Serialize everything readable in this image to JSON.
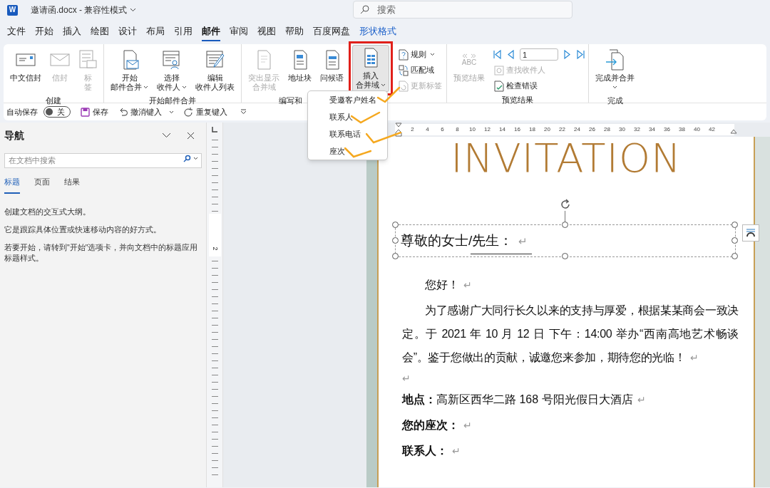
{
  "title_bar": {
    "app_letter": "W",
    "title": "邀请函.docx - 兼容性模式",
    "search_placeholder": "搜索"
  },
  "tabs": [
    {
      "label": "文件",
      "kind": "normal",
      "selected": false
    },
    {
      "label": "开始",
      "kind": "normal",
      "selected": false
    },
    {
      "label": "插入",
      "kind": "normal",
      "selected": false
    },
    {
      "label": "绘图",
      "kind": "normal",
      "selected": false
    },
    {
      "label": "设计",
      "kind": "normal",
      "selected": false
    },
    {
      "label": "布局",
      "kind": "normal",
      "selected": false
    },
    {
      "label": "引用",
      "kind": "normal",
      "selected": false
    },
    {
      "label": "邮件",
      "kind": "normal",
      "selected": true
    },
    {
      "label": "审阅",
      "kind": "normal",
      "selected": false
    },
    {
      "label": "视图",
      "kind": "normal",
      "selected": false
    },
    {
      "label": "帮助",
      "kind": "normal",
      "selected": false
    },
    {
      "label": "百度网盘",
      "kind": "normal",
      "selected": false
    },
    {
      "label": "形状格式",
      "kind": "contextual",
      "selected": false
    }
  ],
  "ribbon": {
    "groups": [
      {
        "label": "创建",
        "items": [
          {
            "kind": "large",
            "lines": [
              "中文信封"
            ],
            "dropdown": false,
            "disabled": false,
            "pressed": false,
            "highlighted": false
          },
          {
            "kind": "large",
            "lines": [
              "信封"
            ],
            "dropdown": false,
            "disabled": true,
            "pressed": false,
            "highlighted": false
          },
          {
            "kind": "large",
            "lines": [
              "标",
              "签"
            ],
            "dropdown": false,
            "disabled": true,
            "pressed": false,
            "highlighted": false
          }
        ]
      },
      {
        "label": "开始邮件合并",
        "items": [
          {
            "kind": "large",
            "lines": [
              "开始",
              "邮件合并"
            ],
            "dropdown": true,
            "disabled": false,
            "pressed": false,
            "highlighted": false
          },
          {
            "kind": "large",
            "lines": [
              "选择",
              "收件人"
            ],
            "dropdown": true,
            "disabled": false,
            "pressed": false,
            "highlighted": false
          },
          {
            "kind": "large",
            "lines": [
              "编辑",
              "收件人列表"
            ],
            "dropdown": false,
            "disabled": false,
            "pressed": false,
            "highlighted": false
          }
        ]
      },
      {
        "label": "编写和",
        "items": [
          {
            "kind": "large",
            "lines": [
              "突出显示",
              "合并域"
            ],
            "dropdown": false,
            "disabled": true,
            "pressed": false,
            "highlighted": false
          },
          {
            "kind": "large",
            "lines": [
              "地址块"
            ],
            "dropdown": false,
            "disabled": false,
            "pressed": false,
            "highlighted": false
          },
          {
            "kind": "large",
            "lines": [
              "问候语"
            ],
            "dropdown": false,
            "disabled": false,
            "pressed": false,
            "highlighted": false
          },
          {
            "kind": "large",
            "lines": [
              "插入",
              "合并域"
            ],
            "dropdown": true,
            "disabled": false,
            "pressed": true,
            "highlighted": true
          },
          {
            "kind": "small",
            "label": "规则",
            "dropdown": true,
            "disabled": false
          },
          {
            "kind": "small",
            "label": "匹配域",
            "dropdown": false,
            "disabled": false
          },
          {
            "kind": "small",
            "label": "更新标签",
            "dropdown": false,
            "disabled": true
          }
        ]
      },
      {
        "label": "预览结果",
        "items": [
          {
            "kind": "large",
            "lines": [
              "预览结果"
            ],
            "icon_text": "ABC",
            "dropdown": false,
            "disabled": true,
            "pressed": false,
            "highlighted": false
          },
          {
            "kind": "record_nav",
            "value": "1"
          },
          {
            "kind": "small",
            "label": "查找收件人",
            "dropdown": false,
            "disabled": true
          },
          {
            "kind": "small",
            "label": "检查错误",
            "dropdown": false,
            "disabled": false
          }
        ]
      },
      {
        "label": "完成",
        "items": [
          {
            "kind": "large",
            "lines": [
              "完成并合并"
            ],
            "dropdown": true,
            "disabled": false,
            "pressed": false,
            "highlighted": false
          }
        ]
      }
    ]
  },
  "quick_access": {
    "autosave_label": "自动保存",
    "autosave": {
      "on": false,
      "label": "关"
    },
    "buttons": [
      {
        "label": "保存",
        "dropdown": false
      },
      {
        "label": "撤消键入",
        "dropdown": true
      },
      {
        "label": "重复键入",
        "dropdown": false
      }
    ]
  },
  "navigation": {
    "title": "导航",
    "search_placeholder": "在文档中搜索",
    "tabs": [
      {
        "label": "标题",
        "selected": true
      },
      {
        "label": "页面",
        "selected": false
      },
      {
        "label": "结果",
        "selected": false
      }
    ],
    "hints": [
      "创建文档的交互式大纲。",
      "它是跟踪具体位置或快速移动内容的好方式。",
      "若要开始，请转到\"开始\"选项卡，并向文档中的标题应用标题样式。"
    ]
  },
  "ruler": {
    "labels": [
      "2",
      "4",
      "6",
      "8",
      "10",
      "12",
      "14",
      "16",
      "18",
      "20",
      "22",
      "24",
      "26",
      "28",
      "30",
      "32",
      "34",
      "36",
      "38",
      "40",
      "42"
    ]
  },
  "vertical_ruler": {
    "labels": [
      "2"
    ]
  },
  "document": {
    "heading": "INVITATION",
    "greeting": {
      "text": "尊敬的女士/先生：",
      "mark": "↵"
    },
    "paragraphs": [
      {
        "kind": "salutation",
        "text": "您好！",
        "mark": "↵"
      },
      {
        "kind": "body",
        "text": "为了感谢广大同行长久以来的支持与厚爱，根据某某商会一致决定。于 2021 年 10 月 12 日 下午：14:00 举办“西南高地艺术畅谈会”。鉴于您做出的贡献，诚邀您来参加，期待您的光临！",
        "mark": "↵"
      },
      {
        "kind": "empty",
        "mark": "↵"
      },
      {
        "kind": "field",
        "text": "**地点：**高新区西华二路 168 号阳光假日大酒店",
        "mark": "↵"
      },
      {
        "kind": "field",
        "text": "**您的座次：**",
        "mark": "↵"
      },
      {
        "kind": "field",
        "text": "**联系人：**",
        "mark": "↵"
      }
    ]
  },
  "merge_field_menu": {
    "items": [
      {
        "label": "受邀客户姓名",
        "ticked": true
      },
      {
        "label": "联系人",
        "ticked": true
      },
      {
        "label": "联系电话",
        "ticked": true
      },
      {
        "label": "座次",
        "ticked": true
      }
    ]
  }
}
